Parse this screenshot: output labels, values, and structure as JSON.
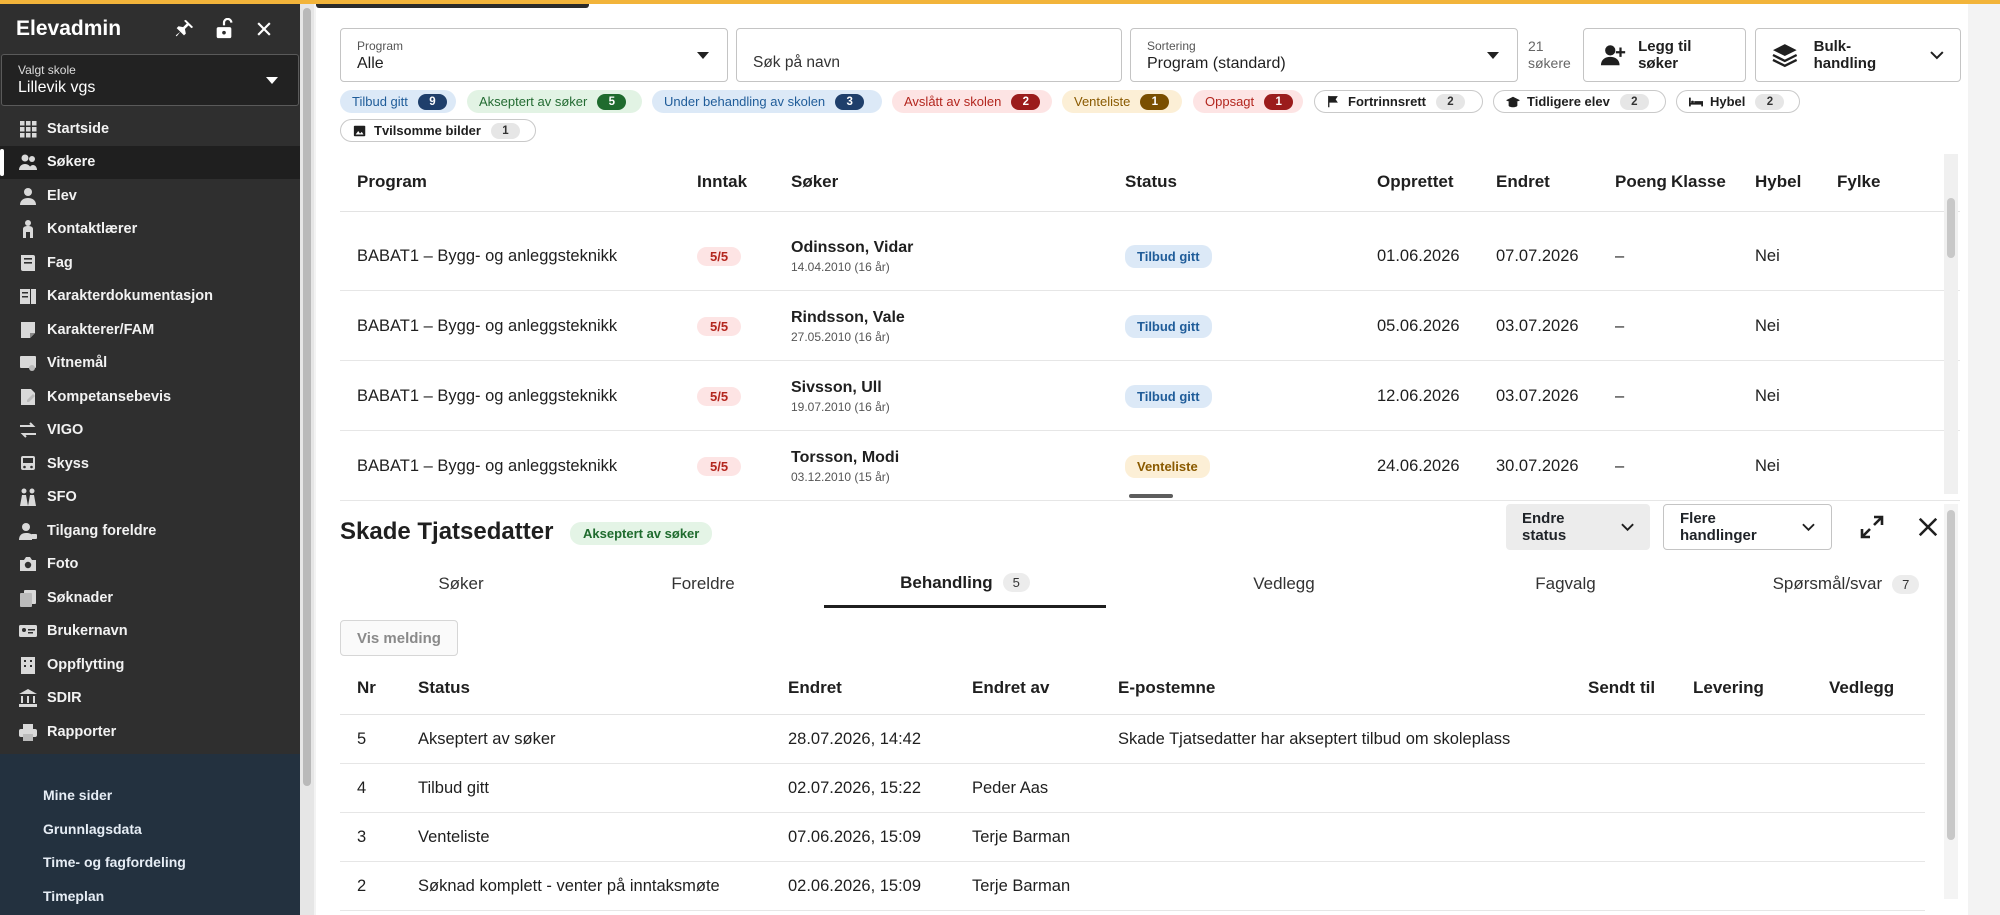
{
  "sidebar": {
    "app_title": "Elevadmin",
    "school_label": "Valgt skole",
    "school_value": "Lillevik vgs",
    "nav": [
      {
        "label": "Startside",
        "icon": "grid-icon"
      },
      {
        "label": "Søkere",
        "icon": "people-icon"
      },
      {
        "label": "Elev",
        "icon": "person-icon"
      },
      {
        "label": "Kontaktlærer",
        "icon": "teacher-icon"
      },
      {
        "label": "Fag",
        "icon": "book-icon"
      },
      {
        "label": "Karakterdokumentasjon",
        "icon": "document-icon"
      },
      {
        "label": "Karakterer/FAM",
        "icon": "grade-icon"
      },
      {
        "label": "Vitnemål",
        "icon": "diploma-icon"
      },
      {
        "label": "Kompetansebevis",
        "icon": "certificate-icon"
      },
      {
        "label": "VIGO",
        "icon": "swap-icon"
      },
      {
        "label": "Skyss",
        "icon": "bus-icon"
      },
      {
        "label": "SFO",
        "icon": "children-icon"
      },
      {
        "label": "Tilgang foreldre",
        "icon": "parent-access-icon"
      },
      {
        "label": "Foto",
        "icon": "camera-icon"
      },
      {
        "label": "Søknader",
        "icon": "copy-icon"
      },
      {
        "label": "Brukernavn",
        "icon": "id-card-icon"
      },
      {
        "label": "Oppflytting",
        "icon": "building-icon"
      },
      {
        "label": "SDIR",
        "icon": "bank-icon"
      },
      {
        "label": "Rapporter",
        "icon": "printer-icon"
      }
    ],
    "sub_nav": [
      "Mine sider",
      "Grunnlagsdata",
      "Time- og fagfordeling",
      "Timeplan"
    ]
  },
  "filters": {
    "program_label": "Program",
    "program_value": "Alle",
    "search_placeholder": "Søk på navn",
    "sort_label": "Sortering",
    "sort_value": "Program (standard)",
    "count_line1": "21",
    "count_line2": "søkere",
    "add_button": "Legg til søker",
    "bulk_button": "Bulk-handling"
  },
  "chips": [
    {
      "label": "Tilbud gitt",
      "count": "9"
    },
    {
      "label": "Akseptert av søker",
      "count": "5"
    },
    {
      "label": "Under behandling av skolen",
      "count": "3"
    },
    {
      "label": "Avslått av skolen",
      "count": "2"
    },
    {
      "label": "Venteliste",
      "count": "1"
    },
    {
      "label": "Oppsagt",
      "count": "1"
    },
    {
      "label": "Fortrinnsrett",
      "count": "2",
      "icon": "flag-icon"
    },
    {
      "label": "Tidligere elev",
      "count": "2",
      "icon": "graduation-cap-icon"
    },
    {
      "label": "Hybel",
      "count": "2",
      "icon": "bed-icon"
    },
    {
      "label": "Tvilsomme bilder",
      "count": "1",
      "icon": "image-icon"
    }
  ],
  "colors": {
    "accent_topline": "#f2b43a",
    "sidebar_bg": "#2f2f2f",
    "subnav_bg": "#23313f",
    "tilbud_bg": "#dce9f7",
    "tilbud_fg": "#1f5c99",
    "venteliste_bg": "#fcefd6",
    "venteliste_fg": "#8a5a00"
  },
  "table": {
    "headers": [
      "Program",
      "Inntak",
      "Søker",
      "Status",
      "Opprettet",
      "Endret",
      "Poeng",
      "Klasse",
      "Hybel",
      "Fylke"
    ],
    "rows": [
      {
        "program": "BABAT1 – Bygg- og anleggsteknikk",
        "inntak": "5/5",
        "name": "Odinsson, Vidar",
        "dob": "14.04.2010 (16 år)",
        "status": "Tilbud gitt",
        "opprettet": "01.06.2026",
        "endret": "07.07.2026",
        "poeng": "–",
        "klasse": "",
        "hybel": "Nei",
        "fylke": ""
      },
      {
        "program": "BABAT1 – Bygg- og anleggsteknikk",
        "inntak": "5/5",
        "name": "Rindsson, Vale",
        "dob": "27.05.2010 (16 år)",
        "status": "Tilbud gitt",
        "opprettet": "05.06.2026",
        "endret": "03.07.2026",
        "poeng": "–",
        "klasse": "",
        "hybel": "Nei",
        "fylke": ""
      },
      {
        "program": "BABAT1 – Bygg- og anleggsteknikk",
        "inntak": "5/5",
        "name": "Sivsson, Ull",
        "dob": "19.07.2010 (16 år)",
        "status": "Tilbud gitt",
        "opprettet": "12.06.2026",
        "endret": "03.07.2026",
        "poeng": "–",
        "klasse": "",
        "hybel": "Nei",
        "fylke": ""
      },
      {
        "program": "BABAT1 – Bygg- og anleggsteknikk",
        "inntak": "5/5",
        "name": "Torsson, Modi",
        "dob": "03.12.2010 (15 år)",
        "status": "Venteliste",
        "opprettet": "24.06.2026",
        "endret": "30.07.2026",
        "poeng": "–",
        "klasse": "",
        "hybel": "Nei",
        "fylke": ""
      }
    ]
  },
  "detail": {
    "name": "Skade Tjatsedatter",
    "status_badge": "Akseptert av søker",
    "change_status_button": "Endre status",
    "more_actions_button": "Flere handlinger",
    "tabs": [
      {
        "label": "Søker",
        "count": ""
      },
      {
        "label": "Foreldre",
        "count": ""
      },
      {
        "label": "Behandling",
        "count": "5"
      },
      {
        "label": "Vedlegg",
        "count": ""
      },
      {
        "label": "Fagvalg",
        "count": ""
      },
      {
        "label": "Spørsmål/svar",
        "count": "7"
      }
    ],
    "show_message_button": "Vis melding",
    "headers": [
      "Nr",
      "Status",
      "Endret",
      "Endret av",
      "E-postemne",
      "Sendt til",
      "Levering",
      "Vedlegg"
    ],
    "rows": [
      {
        "nr": "5",
        "status": "Akseptert av søker",
        "endret": "28.07.2026, 14:42",
        "endret_av": "",
        "emne": "Skade Tjatsedatter har akseptert tilbud om skoleplass"
      },
      {
        "nr": "4",
        "status": "Tilbud gitt",
        "endret": "02.07.2026, 15:22",
        "endret_av": "Peder Aas",
        "emne": ""
      },
      {
        "nr": "3",
        "status": "Venteliste",
        "endret": "07.06.2026, 15:09",
        "endret_av": "Terje Barman",
        "emne": ""
      },
      {
        "nr": "2",
        "status": "Søknad komplett - venter på inntaksmøte",
        "endret": "02.06.2026, 15:09",
        "endret_av": "Terje Barman",
        "emne": ""
      }
    ]
  }
}
